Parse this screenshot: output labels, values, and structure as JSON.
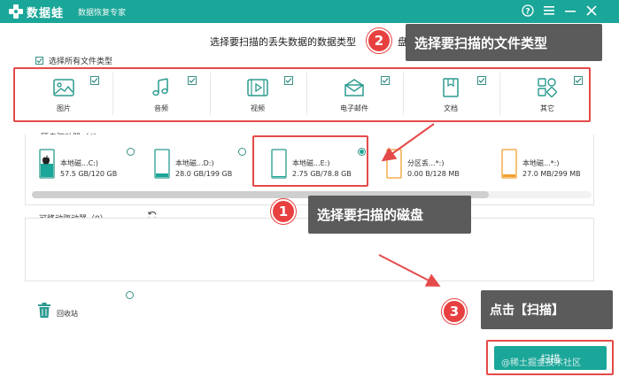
{
  "titlebar": {
    "app_name": "数据蛙",
    "app_sub": "数据恢复专家"
  },
  "main": {
    "prompt": "选择要扫描的丢失数据的数据类型",
    "prompt_tail": "盘",
    "select_all": "选择所有文件类型",
    "file_types": [
      {
        "label": "图片",
        "icon": "image-icon"
      },
      {
        "label": "音频",
        "icon": "music-icon"
      },
      {
        "label": "视频",
        "icon": "video-icon"
      },
      {
        "label": "电子邮件",
        "icon": "mail-icon"
      },
      {
        "label": "文档",
        "icon": "document-icon"
      },
      {
        "label": "其它",
        "icon": "other-icon"
      }
    ]
  },
  "hard_drives": {
    "header": "硬盘驱动器（6）",
    "items": [
      {
        "name": "本地磁...C:)",
        "size": "57.5 GB/120 GB",
        "fill": 0.48,
        "color": "#1aa698"
      },
      {
        "name": "本地磁...D:)",
        "size": "28.0 GB/199 GB",
        "fill": 0.14,
        "color": "#1aa698"
      },
      {
        "name": "本地磁...E:)",
        "size": "2.75 GB/78.8 GB",
        "fill": 0.03,
        "color": "#1aa698"
      },
      {
        "name": "分区丢...*:)",
        "size": "0.00  B/128 MB",
        "fill": 0.0,
        "color": "#f0a030"
      },
      {
        "name": "本地磁...*:)",
        "size": "27.0 MB/299 MB",
        "fill": 0.09,
        "color": "#f0a030"
      }
    ]
  },
  "removable": {
    "header": "可移动驱动器（0）"
  },
  "recycle": {
    "label": "回收站"
  },
  "scan_button": "扫描",
  "callouts": {
    "step1": {
      "number": "1",
      "text": "选择要扫描的磁盘"
    },
    "step2": {
      "number": "2",
      "text": "选择要扫描的文件类型"
    },
    "step3": {
      "number": "3",
      "text": "点击【扫描】"
    }
  },
  "watermark": "@稀土掘金技术社区",
  "colors": {
    "brand": "#1aa698",
    "annotation_red": "#e54a4a",
    "callout_bg": "#5b5b5b"
  }
}
